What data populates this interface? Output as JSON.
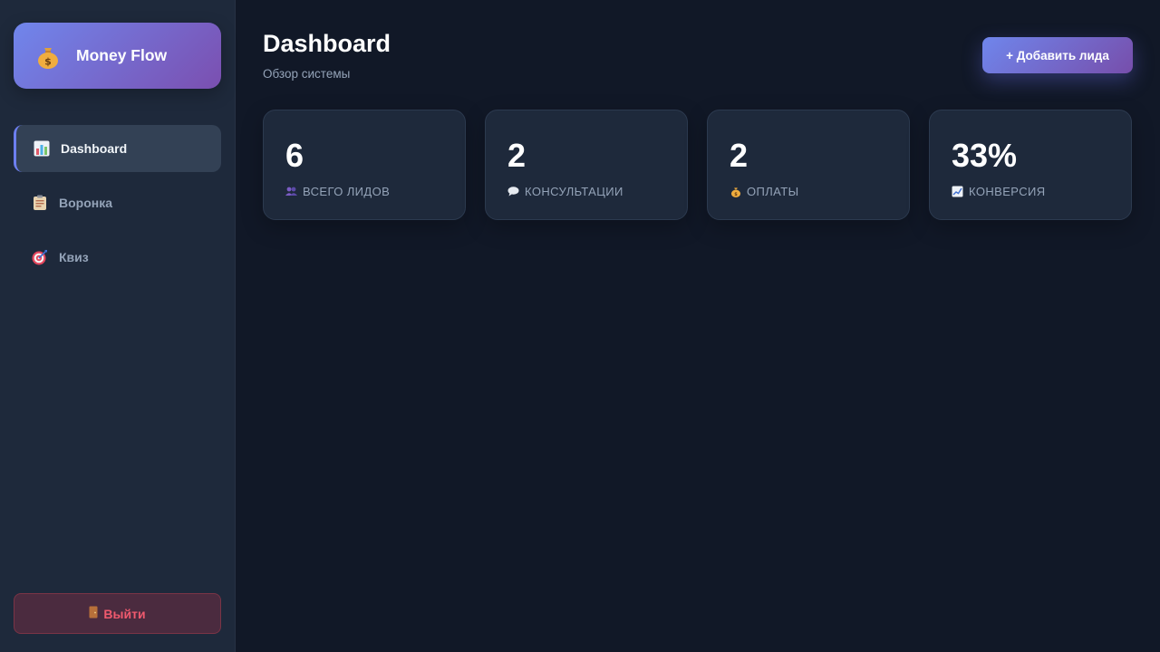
{
  "sidebar": {
    "brand": {
      "icon": "money-bag-icon",
      "title": "Money Flow"
    },
    "items": [
      {
        "icon": "bar-chart-icon",
        "label": "Dashboard",
        "active": true
      },
      {
        "icon": "clipboard-icon",
        "label": "Воронка",
        "active": false
      },
      {
        "icon": "target-icon",
        "label": "Квиз",
        "active": false
      }
    ],
    "logout": {
      "icon": "door-icon",
      "label": "Выйти"
    }
  },
  "header": {
    "title": "Dashboard",
    "subtitle": "Обзор системы",
    "add_button_label": "+ Добавить лида"
  },
  "stats": [
    {
      "value": "6",
      "icon": "people-icon",
      "label": "ВСЕГО ЛИДОВ"
    },
    {
      "value": "2",
      "icon": "speech-bubble-icon",
      "label": "КОНСУЛЬТАЦИИ"
    },
    {
      "value": "2",
      "icon": "money-bag-icon",
      "label": "ОПЛАТЫ"
    },
    {
      "value": "33%",
      "icon": "trend-chart-icon",
      "label": "КОНВЕРСИЯ"
    }
  ],
  "colors": {
    "background": "#111827",
    "sidebar": "#1e293b",
    "accent_start": "#6f86ec",
    "accent_end": "#774eab",
    "danger": "#f05a6e"
  }
}
